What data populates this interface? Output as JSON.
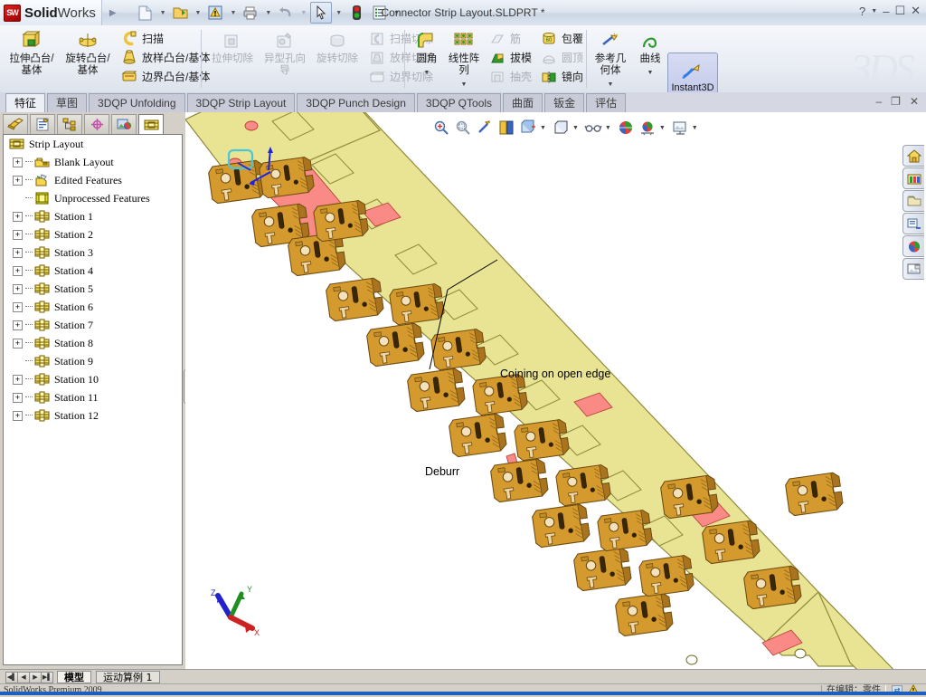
{
  "app": {
    "brand_bold": "Solid",
    "brand_light": "Works",
    "logo_text": "SW",
    "document_title": "Connector Strip Layout.SLDPRT *",
    "watermark": "3DS"
  },
  "titlebar": {
    "quick_access": [
      {
        "name": "new-document",
        "icon": "page-icon",
        "caret": true
      },
      {
        "name": "open-document",
        "icon": "folder-open-icon",
        "caret": true
      },
      {
        "name": "rebuild",
        "icon": "warning-rebuild-icon",
        "caret": true
      },
      {
        "name": "print",
        "icon": "printer-icon",
        "caret": true
      },
      {
        "name": "undo",
        "icon": "undo-arrow-icon",
        "caret": true
      },
      {
        "name": "select",
        "icon": "cursor-arrow-icon",
        "caret": true,
        "selected": true
      },
      {
        "name": "rebuild-status",
        "icon": "traffic-light-icon",
        "caret": false
      },
      {
        "name": "options",
        "icon": "options-list-icon",
        "caret": true
      }
    ],
    "window_controls": [
      "?",
      "▾",
      "–",
      "❐",
      "✕"
    ]
  },
  "ribbon": {
    "groups": [
      {
        "name": "boss-base-group",
        "big": [
          {
            "label": "拉伸凸台/基体",
            "icon": "extrude-boss-icon",
            "enabled": true
          },
          {
            "label": "旋转凸台/基体",
            "icon": "revolve-boss-icon",
            "enabled": true
          }
        ],
        "small": [
          {
            "label": "扫描",
            "icon": "sweep-icon",
            "enabled": true
          },
          {
            "label": "放样凸台/基体",
            "icon": "loft-boss-icon",
            "enabled": true
          },
          {
            "label": "边界凸台/基体",
            "icon": "boundary-boss-icon",
            "enabled": true
          }
        ]
      },
      {
        "name": "cut-group",
        "big": [
          {
            "label": "拉伸切除",
            "icon": "extrude-cut-icon",
            "enabled": false
          },
          {
            "label": "异型孔向导",
            "icon": "hole-wizard-icon",
            "enabled": false
          },
          {
            "label": "旋转切除",
            "icon": "revolve-cut-icon",
            "enabled": false
          }
        ],
        "small": [
          {
            "label": "扫描切除",
            "icon": "sweep-cut-icon",
            "enabled": false
          },
          {
            "label": "放样切割",
            "icon": "loft-cut-icon",
            "enabled": false
          },
          {
            "label": "边界切除",
            "icon": "boundary-cut-icon",
            "enabled": false
          }
        ]
      },
      {
        "name": "feature-group",
        "big": [
          {
            "label": "圆角",
            "icon": "fillet-icon",
            "enabled": true,
            "caret": true
          },
          {
            "label": "线性阵列",
            "icon": "linear-pattern-icon",
            "enabled": true,
            "caret": true
          }
        ],
        "small": [
          {
            "label": "筋",
            "icon": "rib-icon",
            "enabled": false
          },
          {
            "label": "拔模",
            "icon": "draft-icon",
            "enabled": true
          },
          {
            "label": "抽壳",
            "icon": "shell-icon",
            "enabled": false
          }
        ],
        "small2": [
          {
            "label": "包覆",
            "icon": "wrap-icon",
            "enabled": true
          },
          {
            "label": "圆顶",
            "icon": "dome-icon",
            "enabled": false
          },
          {
            "label": "镜向",
            "icon": "mirror-icon",
            "enabled": true
          }
        ]
      },
      {
        "name": "reference-group",
        "big": [
          {
            "label": "参考几何体",
            "icon": "reference-geometry-icon",
            "enabled": true,
            "caret": true
          },
          {
            "label": "曲线",
            "icon": "curves-icon",
            "enabled": true,
            "caret": true
          }
        ],
        "small": []
      }
    ],
    "instant3d": {
      "label": "Instant3D",
      "icon": "instant3d-icon",
      "active": true
    }
  },
  "tabbar": {
    "tabs": [
      {
        "label": "特征",
        "active": true,
        "cjk": true
      },
      {
        "label": "草图",
        "active": false,
        "cjk": true
      },
      {
        "label": "3DQP Unfolding",
        "active": false,
        "cjk": false
      },
      {
        "label": "3DQP Strip Layout",
        "active": false,
        "cjk": false
      },
      {
        "label": "3DQP Punch Design",
        "active": false,
        "cjk": false
      },
      {
        "label": "3DQP QTools",
        "active": false,
        "cjk": false
      },
      {
        "label": "曲面",
        "active": false,
        "cjk": true
      },
      {
        "label": "钣金",
        "active": false,
        "cjk": true
      },
      {
        "label": "评估",
        "active": false,
        "cjk": true
      }
    ],
    "mdi_controls": [
      "–",
      "❐",
      "✕"
    ]
  },
  "tree_panel": {
    "tabs": [
      {
        "name": "feature-manager-tab",
        "icon": "feature-tree-icon",
        "active": false
      },
      {
        "name": "property-manager-tab",
        "icon": "property-sheet-icon",
        "active": false
      },
      {
        "name": "configuration-manager-tab",
        "icon": "configuration-icon",
        "active": false
      },
      {
        "name": "dimxpert-tab",
        "icon": "dimxpert-icon",
        "active": false
      },
      {
        "name": "display-manager-tab",
        "icon": "display-palette-icon",
        "active": false
      },
      {
        "name": "strip-layout-tab",
        "icon": "strip-layout-icon",
        "active": true
      }
    ],
    "nodes": [
      {
        "label": "Strip Layout",
        "icon": "strip-layout-icon",
        "expandable": false,
        "root": true
      },
      {
        "label": "Blank Layout",
        "icon": "blank-layout-icon",
        "expandable": true,
        "root": false
      },
      {
        "label": "Edited Features",
        "icon": "edited-features-icon",
        "expandable": true,
        "root": false
      },
      {
        "label": "Unprocessed Features",
        "icon": "unprocessed-features-icon",
        "expandable": false,
        "root": false
      },
      {
        "label": "Station 1",
        "icon": "station-icon",
        "expandable": true,
        "root": false
      },
      {
        "label": "Station 2",
        "icon": "station-icon",
        "expandable": true,
        "root": false
      },
      {
        "label": "Station 3",
        "icon": "station-icon",
        "expandable": true,
        "root": false
      },
      {
        "label": "Station 4",
        "icon": "station-icon",
        "expandable": true,
        "root": false
      },
      {
        "label": "Station 5",
        "icon": "station-icon",
        "expandable": true,
        "root": false
      },
      {
        "label": "Station 6",
        "icon": "station-icon",
        "expandable": true,
        "root": false
      },
      {
        "label": "Station 7",
        "icon": "station-icon",
        "expandable": true,
        "root": false
      },
      {
        "label": "Station 8",
        "icon": "station-icon",
        "expandable": true,
        "root": false
      },
      {
        "label": "Station 9",
        "icon": "station-icon",
        "expandable": false,
        "root": false
      },
      {
        "label": "Station 10",
        "icon": "station-icon",
        "expandable": true,
        "root": false
      },
      {
        "label": "Station 11",
        "icon": "station-icon",
        "expandable": true,
        "root": false
      },
      {
        "label": "Station 12",
        "icon": "station-icon",
        "expandable": true,
        "root": false
      }
    ]
  },
  "viewport": {
    "toolbar": [
      {
        "name": "zoom-to-fit-button",
        "icon": "zoom-fit-icon",
        "caret": false
      },
      {
        "name": "zoom-to-area-button",
        "icon": "zoom-area-icon",
        "caret": false
      },
      {
        "name": "previous-view-button",
        "icon": "previous-view-icon",
        "caret": false
      },
      {
        "name": "section-view-button",
        "icon": "section-view-icon",
        "caret": false
      },
      {
        "name": "view-orientation-button",
        "icon": "view-orientation-icon",
        "caret": true
      },
      {
        "name": "display-style-button",
        "icon": "display-style-cube-icon",
        "caret": true
      },
      {
        "name": "hide-show-items-button",
        "icon": "glasses-icon",
        "caret": true
      },
      {
        "name": "edit-appearance-button",
        "icon": "appearance-sphere-icon",
        "caret": false
      },
      {
        "name": "apply-scene-button",
        "icon": "scene-icon",
        "caret": true
      },
      {
        "name": "view-settings-button",
        "icon": "view-settings-icon",
        "caret": true
      }
    ],
    "annotations": [
      {
        "name": "coining-callout",
        "text": "Coining on open edge"
      },
      {
        "name": "deburr-callout",
        "text": "Deburr"
      }
    ],
    "triad": {
      "x_label": "X",
      "y_label": "Y",
      "z_label": "Z",
      "x_color": "#cc2222",
      "y_color": "#1f8f1f",
      "z_color": "#2222cc"
    },
    "model": {
      "strip_color": "#e8e493",
      "strip_edge_color": "#9a9640",
      "part_color": "#d49a2e",
      "part_dark_color": "#a9741d",
      "highlight_color": "#f98a86",
      "pilot_hole_color": "#ffffff"
    }
  },
  "taskpane": {
    "buttons": [
      {
        "name": "sw-resources-button",
        "icon": "home-icon"
      },
      {
        "name": "design-library-button",
        "icon": "library-icon"
      },
      {
        "name": "file-explorer-button",
        "icon": "folder-icon"
      },
      {
        "name": "search-button",
        "icon": "search-pane-icon"
      },
      {
        "name": "view-palette-button",
        "icon": "palette-sphere-icon"
      },
      {
        "name": "appearances-button",
        "icon": "appearances-icon"
      }
    ]
  },
  "bottom": {
    "nav_buttons": [
      "◀▌",
      "◀",
      "▶",
      "▶▌"
    ],
    "sheet_tabs": [
      {
        "label": "模型",
        "active": true
      },
      {
        "label": "运动算例 1",
        "active": false
      }
    ]
  },
  "statusbar": {
    "left_text": "SolidWorks Premium 2009",
    "right_cells": [
      "在编辑：零件"
    ],
    "indicator_icon": "sync-icon",
    "warning_icon": "warning-triangle-icon"
  }
}
